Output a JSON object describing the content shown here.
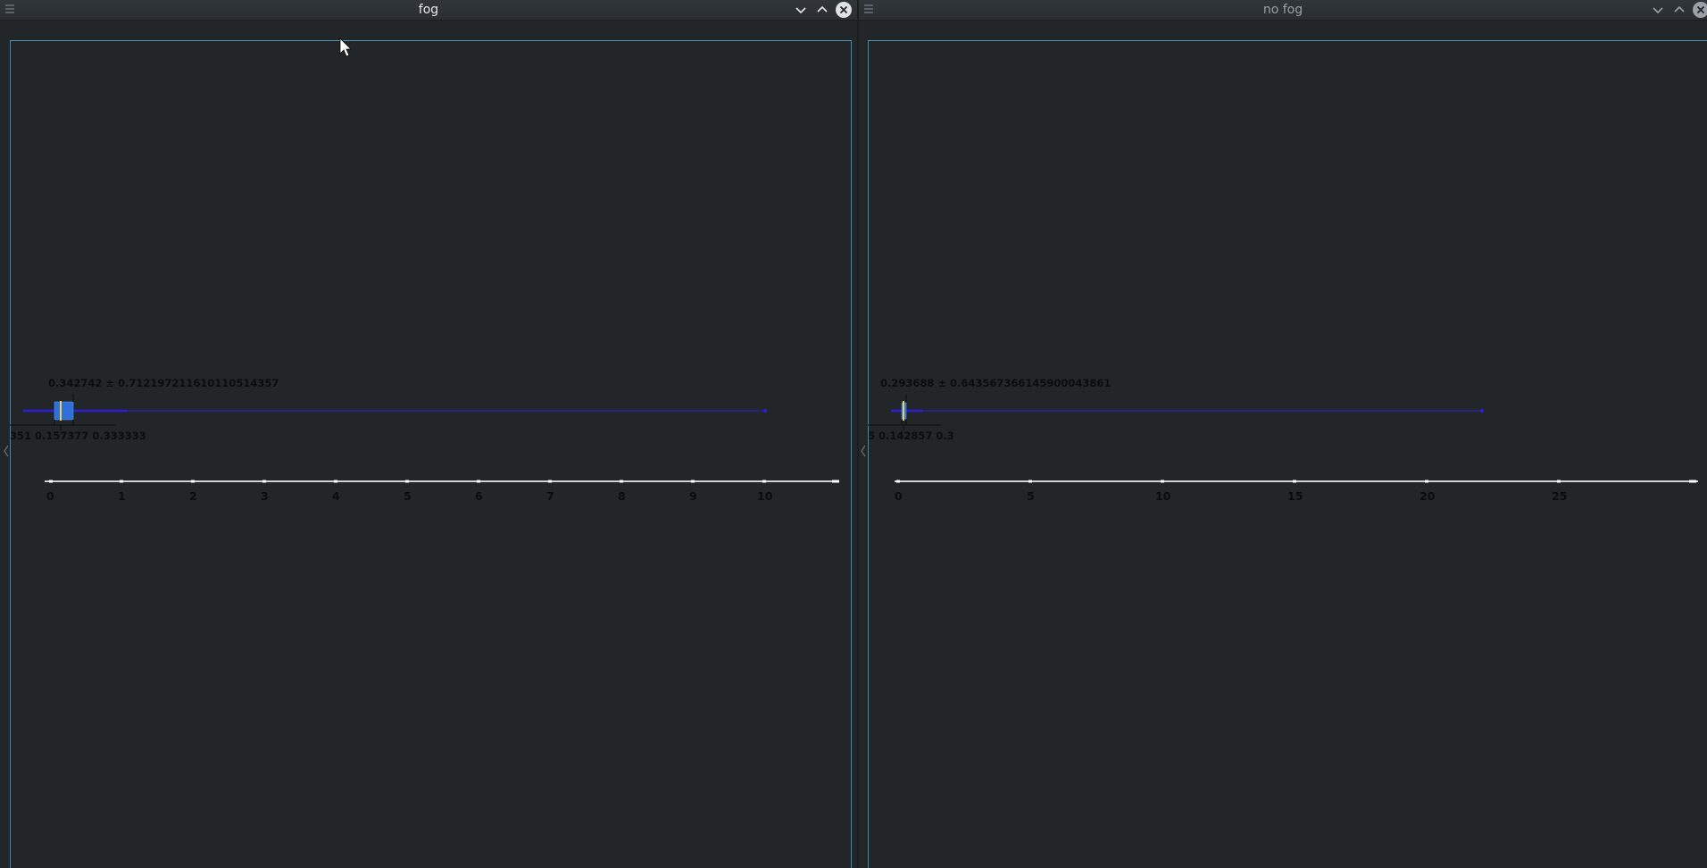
{
  "windows": [
    {
      "title": "fog",
      "stats_label": "0.342742 ± 0.712197211610110514357",
      "quantile_labels": "351  0.157377  0.333333",
      "axis_ticks": [
        "0",
        "1",
        "2",
        "3",
        "4",
        "5",
        "6",
        "7",
        "8",
        "9",
        "10"
      ],
      "title_color": "#e6e8ea",
      "buttons": {
        "minimize": "chevron-down-icon",
        "maximize": "chevron-up-icon",
        "close": "close-icon"
      }
    },
    {
      "title": "no fog",
      "stats_label": "0.293688 ± 0.643567366145900043861",
      "quantile_labels": "5 0.142857  0.3",
      "axis_ticks": [
        "0",
        "5",
        "10",
        "15",
        "20",
        "25"
      ],
      "title_color": "#9aa0a6",
      "buttons": {
        "minimize": "chevron-down-icon",
        "maximize": "chevron-up-icon",
        "close": "close-icon"
      }
    }
  ],
  "colors": {
    "plot_border": "#3d8ab3",
    "box_fill": "#2f6fd6",
    "whisker": "#2b1fd8",
    "axis": "#cfd2d5"
  }
}
